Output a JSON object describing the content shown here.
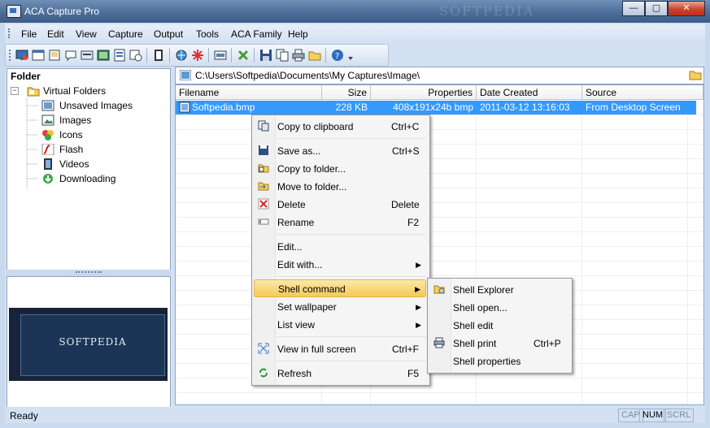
{
  "window": {
    "title": "ACA Capture Pro",
    "watermark": "SOFTPEDIA",
    "buttons": {
      "minimize": "—",
      "maximize": "▢",
      "close": "✕"
    }
  },
  "menu": [
    "File",
    "Edit",
    "View",
    "Capture",
    "Output",
    "Tools",
    "ACA Family",
    "Help"
  ],
  "folder_panel": {
    "title": "Folder",
    "root": "Virtual Folders",
    "items": [
      "Unsaved Images",
      "Images",
      "Icons",
      "Flash",
      "Videos",
      "Downloading"
    ]
  },
  "preview": {
    "text": "SOFTPEDIA"
  },
  "path": "C:\\Users\\Softpedia\\Documents\\My Captures\\Image\\",
  "columns": [
    "Filename",
    "Size",
    "Properties",
    "Date Created",
    "Source"
  ],
  "files": [
    {
      "name": "Softpedia.bmp",
      "size": "228 KB",
      "properties": "408x191x24b bmp",
      "date": "2011-03-12 13:16:03",
      "source": "From Desktop Screen"
    }
  ],
  "context_menu": [
    {
      "label": "Copy to clipboard",
      "shortcut": "Ctrl+C",
      "icon": "copy-icon"
    },
    {
      "label": "Save as...",
      "shortcut": "Ctrl+S",
      "icon": "save-icon"
    },
    {
      "label": "Copy to folder...",
      "shortcut": "",
      "icon": "copy-folder-icon"
    },
    {
      "label": "Move to folder...",
      "shortcut": "",
      "icon": "move-folder-icon"
    },
    {
      "label": "Delete",
      "shortcut": "Delete",
      "icon": "delete-icon"
    },
    {
      "label": "Rename",
      "shortcut": "F2",
      "icon": "rename-icon"
    },
    {
      "label": "Edit...",
      "shortcut": "",
      "icon": ""
    },
    {
      "label": "Edit with...",
      "shortcut": "",
      "icon": "",
      "submenu": true
    },
    {
      "label": "Shell command",
      "shortcut": "",
      "icon": "",
      "submenu": true,
      "highlighted": true
    },
    {
      "label": "Set wallpaper",
      "shortcut": "",
      "icon": "",
      "submenu": true
    },
    {
      "label": "List view",
      "shortcut": "",
      "icon": "",
      "submenu": true
    },
    {
      "label": "View in full screen",
      "shortcut": "Ctrl+F",
      "icon": "fullscreen-icon"
    },
    {
      "label": "Refresh",
      "shortcut": "F5",
      "icon": "refresh-icon"
    }
  ],
  "shell_submenu": [
    {
      "label": "Shell Explorer",
      "shortcut": "",
      "icon": "folder-open-icon"
    },
    {
      "label": "Shell open...",
      "shortcut": "",
      "icon": ""
    },
    {
      "label": "Shell edit",
      "shortcut": "",
      "icon": ""
    },
    {
      "label": "Shell print",
      "shortcut": "Ctrl+P",
      "icon": "printer-icon"
    },
    {
      "label": "Shell properties",
      "shortcut": "",
      "icon": ""
    }
  ],
  "status": {
    "text": "Ready",
    "indicators": [
      "CAP",
      "NUM",
      "SCRL"
    ],
    "active": "NUM"
  },
  "colors": {
    "selection": "#3399ff",
    "highlight": "#f5c957",
    "frame": "#d3e1f3"
  }
}
